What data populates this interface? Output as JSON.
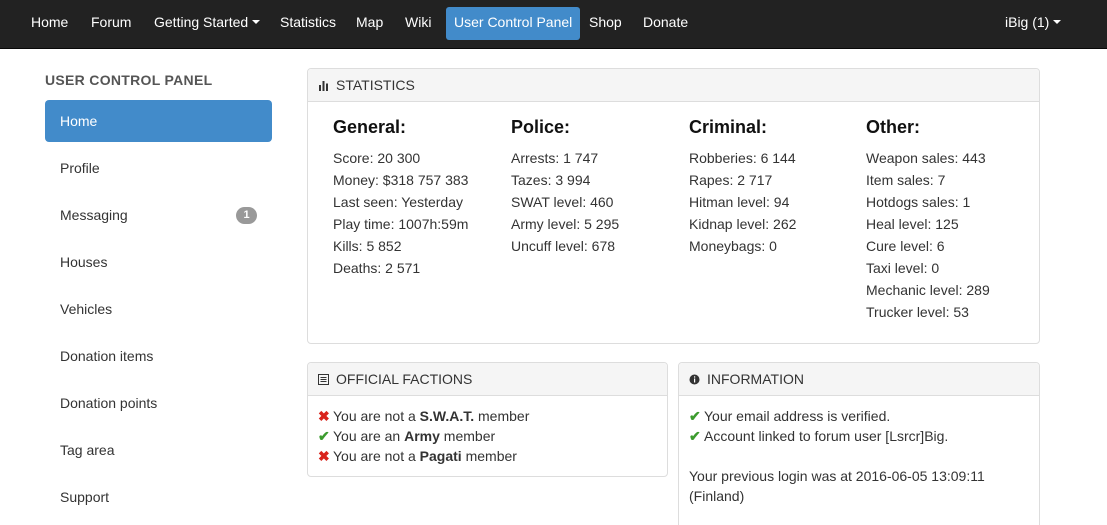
{
  "navbar": {
    "items": [
      {
        "label": "Home"
      },
      {
        "label": "Forum"
      },
      {
        "label": "Getting Started"
      },
      {
        "label": "Statistics"
      },
      {
        "label": "Map"
      },
      {
        "label": "Wiki"
      },
      {
        "label": "User Control Panel"
      },
      {
        "label": "Shop"
      },
      {
        "label": "Donate"
      }
    ],
    "user_label": "iBig (1)",
    "active_color": "#428bca",
    "bg_color": "#222222"
  },
  "sidebar": {
    "title": "USER CONTROL PANEL",
    "items": [
      {
        "label": "Home"
      },
      {
        "label": "Profile"
      },
      {
        "label": "Messaging",
        "badge": "1"
      },
      {
        "label": "Houses"
      },
      {
        "label": "Vehicles"
      },
      {
        "label": "Donation items"
      },
      {
        "label": "Donation points"
      },
      {
        "label": "Tag area"
      },
      {
        "label": "Support"
      }
    ]
  },
  "statistics": {
    "title": "STATISTICS",
    "icon": "bar-chart-icon",
    "general": {
      "heading": "General:",
      "rows": [
        "Score: 20 300",
        "Money: $318 757 383",
        "Last seen: Yesterday",
        "Play time: 1007h:59m",
        "Kills: 5 852",
        "Deaths: 2 571"
      ]
    },
    "police": {
      "heading": "Police:",
      "rows": [
        "Arrests: 1 747",
        "Tazes: 3 994",
        "SWAT level: 460",
        "Army level: 5 295",
        "Uncuff level: 678"
      ]
    },
    "criminal": {
      "heading": "Criminal:",
      "rows": [
        "Robberies: 6 144",
        "Rapes: 2 717",
        "Hitman level: 94",
        "Kidnap level: 262",
        "Moneybags: 0"
      ]
    },
    "other": {
      "heading": "Other:",
      "rows": [
        "Weapon sales: 443",
        "Item sales: 7",
        "Hotdogs sales: 1",
        "Heal level: 125",
        "Cure level: 6",
        "Taxi level: 0",
        "Mechanic level: 289",
        "Trucker level: 53"
      ]
    }
  },
  "factions": {
    "title": "OFFICIAL FACTIONS",
    "icon": "list-icon",
    "rows": [
      {
        "status": "no",
        "pre": "You are not a",
        "name": "S.W.A.T.",
        "post": "member"
      },
      {
        "status": "yes",
        "pre": "You are an",
        "name": "Army",
        "post": "member"
      },
      {
        "status": "no",
        "pre": "You are not a",
        "name": "Pagati",
        "post": "member"
      }
    ],
    "yes_symbol": "✔",
    "no_symbol": "✖",
    "yes_color": "#3c9b2e",
    "no_color": "#d9241c"
  },
  "information": {
    "title": "INFORMATION",
    "icon": "info-circle-icon",
    "checks": [
      "Your email address is verified.",
      "Account linked to forum user [Lsrcr]Big."
    ],
    "previous_login_line1": "Your previous login was at 2016-06-05 13:09:11",
    "previous_login_line2": "(Finland)"
  }
}
